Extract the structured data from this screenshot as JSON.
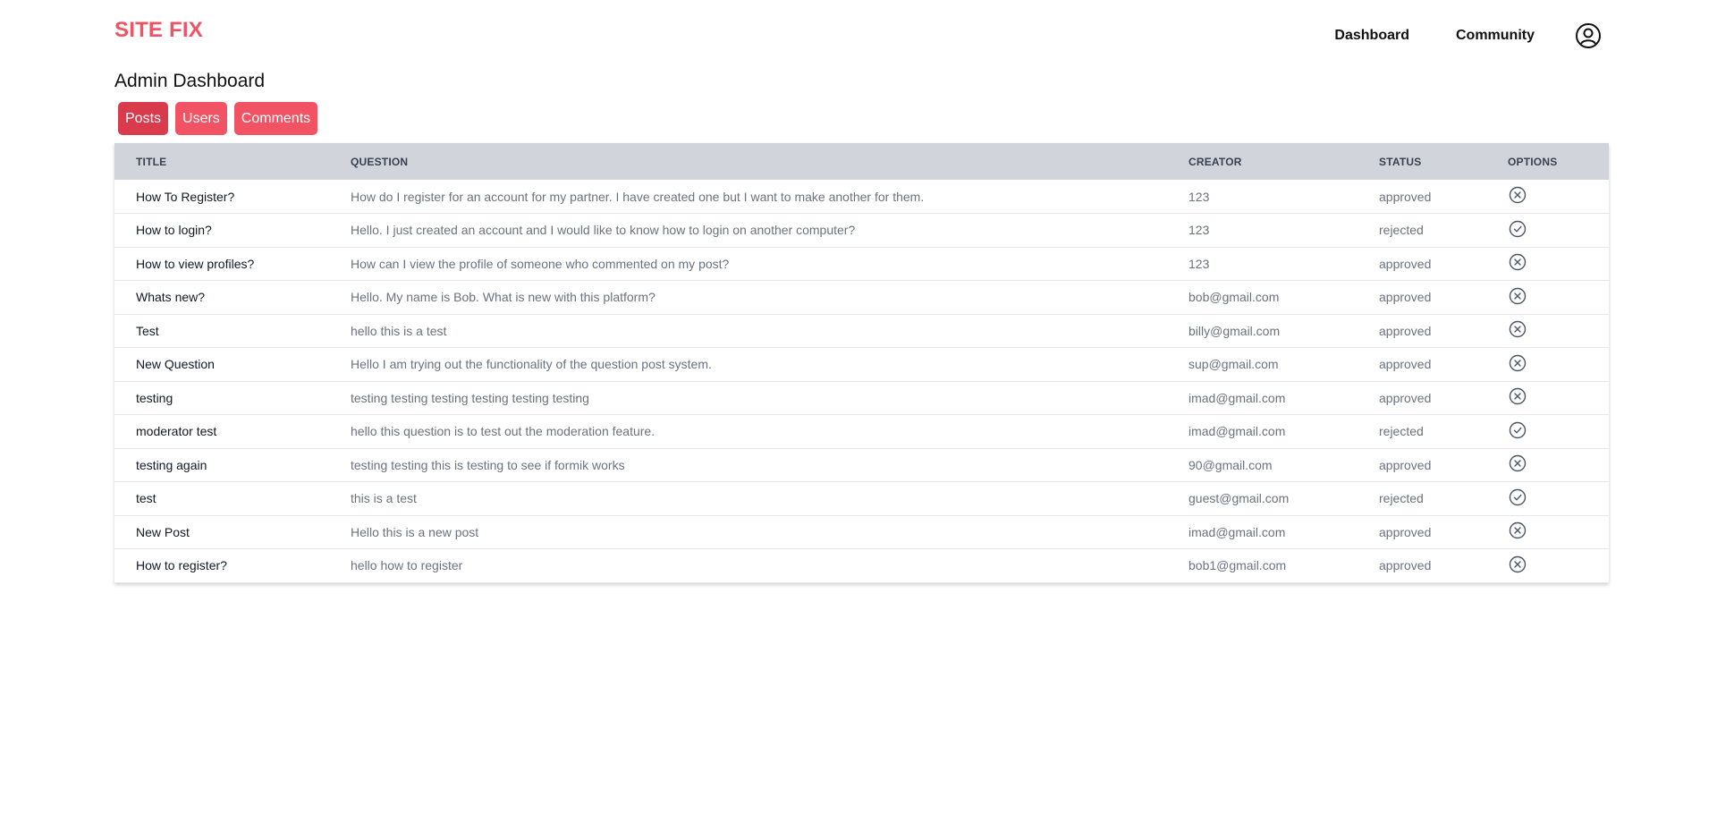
{
  "brand": "SITE FIX",
  "nav": {
    "dashboard": "Dashboard",
    "community": "Community",
    "user_icon": "user-circle-icon"
  },
  "page_title": "Admin Dashboard",
  "tabs": [
    {
      "label": "Posts",
      "active": true
    },
    {
      "label": "Users",
      "active": false
    },
    {
      "label": "Comments",
      "active": false
    }
  ],
  "table": {
    "headers": [
      "TITLE",
      "QUESTION",
      "CREATOR",
      "STATUS",
      "OPTIONS"
    ],
    "rows": [
      {
        "title": "How To Register?",
        "question": "How do I register for an account for my partner. I have created one but I want to make another for them.",
        "creator": "123",
        "status": "approved",
        "option_icon": "x-circle-icon"
      },
      {
        "title": "How to login?",
        "question": "Hello. I just created an account and I would like to know how to login on another computer?",
        "creator": "123",
        "status": "rejected",
        "option_icon": "check-circle-icon"
      },
      {
        "title": "How to view profiles?",
        "question": "How can I view the profile of someone who commented on my post?",
        "creator": "123",
        "status": "approved",
        "option_icon": "x-circle-icon"
      },
      {
        "title": "Whats new?",
        "question": "Hello. My name is Bob. What is new with this platform?",
        "creator": "bob@gmail.com",
        "status": "approved",
        "option_icon": "x-circle-icon"
      },
      {
        "title": "Test",
        "question": "hello this is a test",
        "creator": "billy@gmail.com",
        "status": "approved",
        "option_icon": "x-circle-icon"
      },
      {
        "title": "New Question",
        "question": "Hello I am trying out the functionality of the question post system.",
        "creator": "sup@gmail.com",
        "status": "approved",
        "option_icon": "x-circle-icon"
      },
      {
        "title": "testing",
        "question": "testing testing testing testing testing testing",
        "creator": "imad@gmail.com",
        "status": "approved",
        "option_icon": "x-circle-icon"
      },
      {
        "title": "moderator test",
        "question": "hello this question is to test out the moderation feature.",
        "creator": "imad@gmail.com",
        "status": "rejected",
        "option_icon": "check-circle-icon"
      },
      {
        "title": "testing again",
        "question": "testing testing this is testing to see if formik works",
        "creator": "90@gmail.com",
        "status": "approved",
        "option_icon": "x-circle-icon"
      },
      {
        "title": "test",
        "question": "this is a test",
        "creator": "guest@gmail.com",
        "status": "rejected",
        "option_icon": "check-circle-icon"
      },
      {
        "title": "New Post",
        "question": "Hello this is a new post",
        "creator": "imad@gmail.com",
        "status": "approved",
        "option_icon": "x-circle-icon"
      },
      {
        "title": "How to register?",
        "question": "hello how to register",
        "creator": "bob1@gmail.com",
        "status": "approved",
        "option_icon": "x-circle-icon"
      }
    ]
  },
  "colors": {
    "brand": "#f25364",
    "tab_active": "#d93a4c",
    "header_bg": "#d1d5db",
    "text_muted": "#6b7280"
  }
}
